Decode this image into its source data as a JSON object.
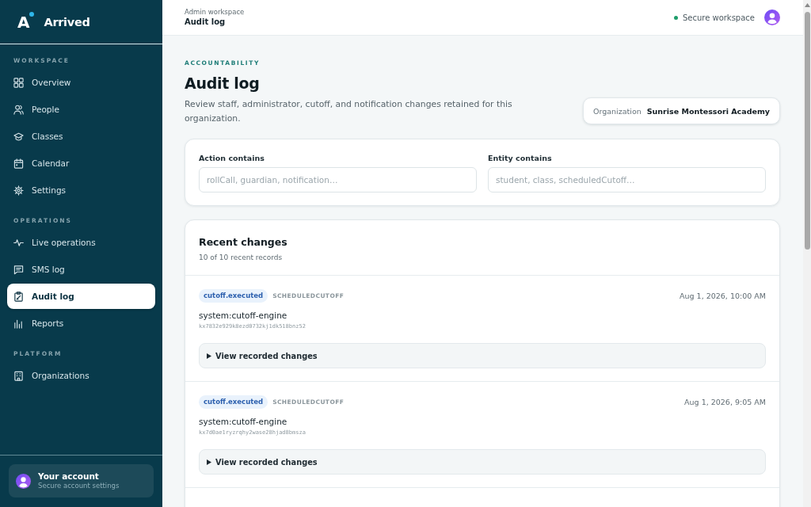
{
  "brand": {
    "mark": "A",
    "name": "Arrived"
  },
  "sidebar": {
    "sections": [
      {
        "label": "WORKSPACE",
        "items": [
          {
            "label": "Overview",
            "selected": false
          },
          {
            "label": "People",
            "selected": false
          },
          {
            "label": "Classes",
            "selected": false
          },
          {
            "label": "Calendar",
            "selected": false
          },
          {
            "label": "Settings",
            "selected": false
          }
        ]
      },
      {
        "label": "OPERATIONS",
        "items": [
          {
            "label": "Live operations",
            "selected": false
          },
          {
            "label": "SMS log",
            "selected": false
          },
          {
            "label": "Audit log",
            "selected": true
          },
          {
            "label": "Reports",
            "selected": false
          }
        ]
      },
      {
        "label": "PLATFORM",
        "items": [
          {
            "label": "Organizations",
            "selected": false
          }
        ]
      }
    ],
    "account": {
      "title": "Your account",
      "subtitle": "Secure account settings"
    }
  },
  "header": {
    "breadcrumb": "Admin workspace",
    "title": "Audit log",
    "status": "Secure workspace"
  },
  "page": {
    "eyebrow": "ACCOUNTABILITY",
    "title": "Audit log",
    "description": "Review staff, administrator, cutoff, and notification changes retained for this organization.",
    "organization": {
      "label": "Organization",
      "value": "Sunrise Montessori Academy"
    }
  },
  "filters": [
    {
      "label": "Action contains",
      "placeholder": "rollCall, guardian, notification…"
    },
    {
      "label": "Entity contains",
      "placeholder": "student, class, scheduledCutoff…"
    }
  ],
  "recent": {
    "title": "Recent changes",
    "count": "10 of 10 recent records",
    "records": [
      {
        "action": "cutoff.executed",
        "entity": "SCHEDULEDCUTOFF",
        "time": "Aug 1, 2026, 10:00 AM",
        "actor": "system:cutoff-engine",
        "id": "kx7832e929k8ezd0732kj1dk518bnz52",
        "details": {
          "label": "View recorded changes",
          "expanded": false
        }
      },
      {
        "action": "cutoff.executed",
        "entity": "SCHEDULEDCUTOFF",
        "time": "Aug 1, 2026, 9:05 AM",
        "actor": "system:cutoff-engine",
        "id": "kx7d0ae1ryzrqhy2wase28hjad8bmsza",
        "details": {
          "label": "View recorded changes",
          "expanded": false
        }
      }
    ]
  }
}
